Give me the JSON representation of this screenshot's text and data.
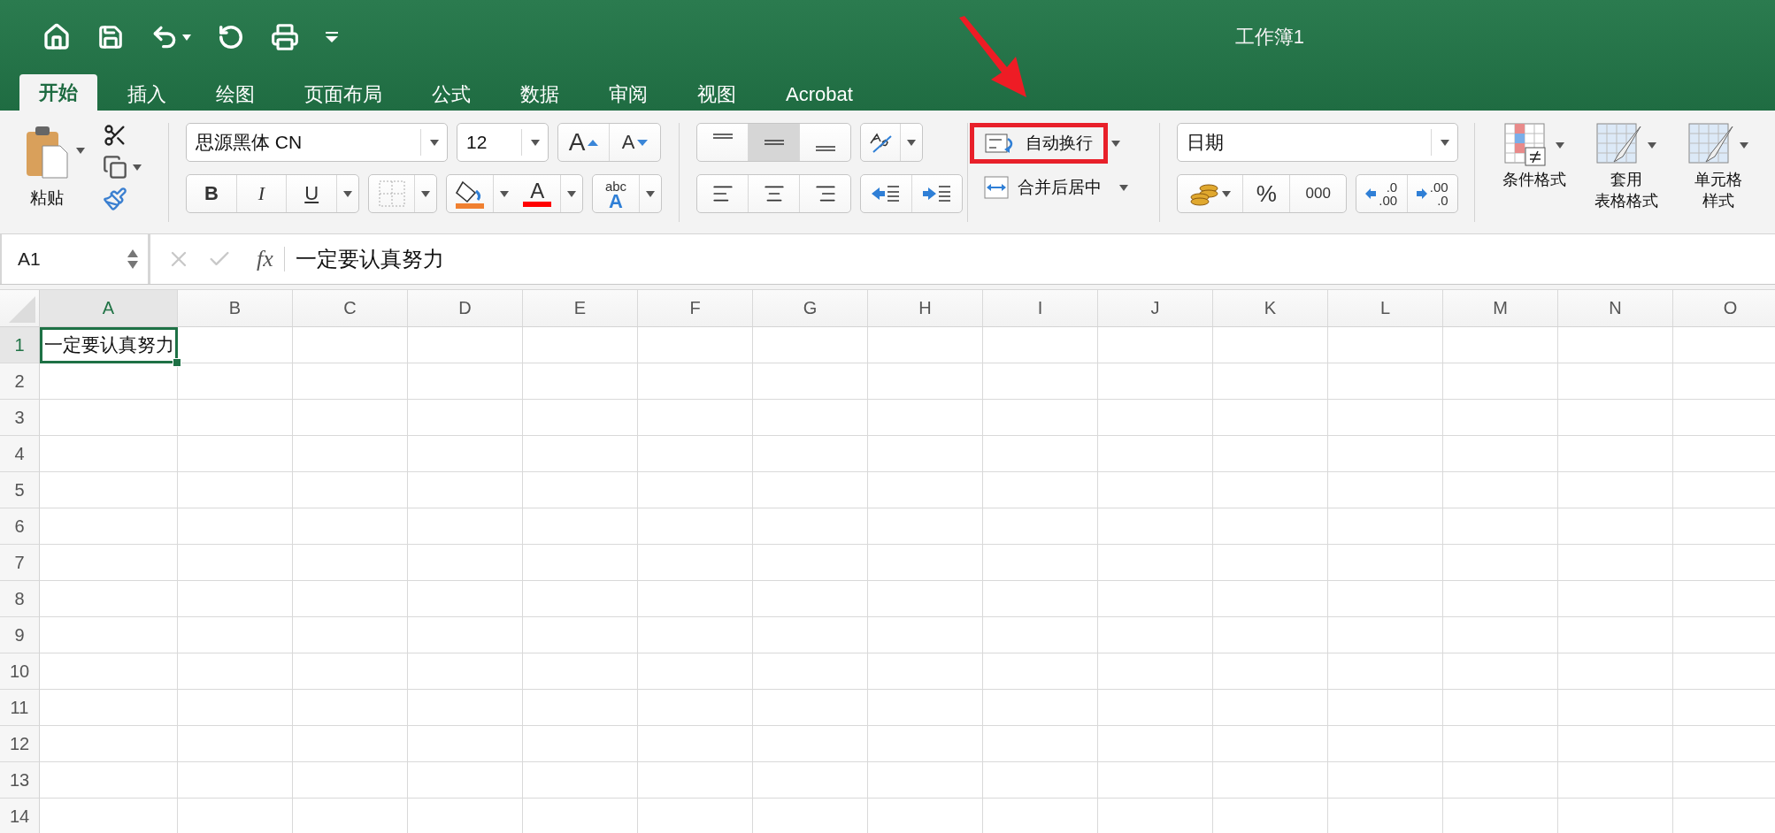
{
  "window": {
    "title": "工作簿1"
  },
  "tabs": [
    {
      "label": "开始",
      "selected": true
    },
    {
      "label": "插入",
      "selected": false
    },
    {
      "label": "绘图",
      "selected": false
    },
    {
      "label": "页面布局",
      "selected": false
    },
    {
      "label": "公式",
      "selected": false
    },
    {
      "label": "数据",
      "selected": false
    },
    {
      "label": "审阅",
      "selected": false
    },
    {
      "label": "视图",
      "selected": false
    },
    {
      "label": "Acrobat",
      "selected": false
    }
  ],
  "ribbon": {
    "paste": {
      "label": "粘贴"
    },
    "font": {
      "name": "思源黑体 CN",
      "size": "12",
      "grow_label": "A",
      "shrink_label": "A",
      "styles": [
        "B",
        "I",
        "U"
      ],
      "color_label": "A",
      "phonetic": [
        "abc",
        "A"
      ]
    },
    "alignment": {
      "vertical": [
        {
          "selected": false
        },
        {
          "selected": true
        },
        {
          "selected": false
        }
      ]
    },
    "wrap_text": {
      "label": "自动换行",
      "highlighted": true
    },
    "merge": {
      "label": "合并后居中"
    },
    "number": {
      "format": "日期",
      "percent": "%",
      "thousands": "000",
      "increase_decimal": [
        ".0",
        ".00"
      ],
      "decrease_decimal": [
        ".00",
        ".0"
      ]
    },
    "styles": [
      {
        "lines": [
          "条件格式"
        ]
      },
      {
        "lines": [
          "套用",
          "表格格式"
        ]
      },
      {
        "lines": [
          "单元格",
          "样式"
        ]
      }
    ]
  },
  "formula_bar": {
    "name_box": "A1",
    "fx": "fx",
    "formula": "一定要认真努力"
  },
  "sheet": {
    "columns": [
      {
        "label": "A",
        "selected": true
      },
      {
        "label": "B",
        "selected": false
      },
      {
        "label": "C",
        "selected": false
      },
      {
        "label": "D",
        "selected": false
      },
      {
        "label": "E",
        "selected": false
      },
      {
        "label": "F",
        "selected": false
      },
      {
        "label": "G",
        "selected": false
      },
      {
        "label": "H",
        "selected": false
      },
      {
        "label": "I",
        "selected": false
      },
      {
        "label": "J",
        "selected": false
      },
      {
        "label": "K",
        "selected": false
      },
      {
        "label": "L",
        "selected": false
      },
      {
        "label": "M",
        "selected": false
      },
      {
        "label": "N",
        "selected": false
      },
      {
        "label": "O",
        "selected": false
      }
    ],
    "rows": [
      {
        "label": "1",
        "selected": true,
        "value": "一定要认真努力"
      },
      {
        "label": "2",
        "selected": false
      },
      {
        "label": "3",
        "selected": false
      },
      {
        "label": "4",
        "selected": false
      },
      {
        "label": "5",
        "selected": false
      },
      {
        "label": "6",
        "selected": false
      },
      {
        "label": "7",
        "selected": false
      },
      {
        "label": "8",
        "selected": false
      },
      {
        "label": "9",
        "selected": false
      },
      {
        "label": "10",
        "selected": false
      },
      {
        "label": "11",
        "selected": false
      },
      {
        "label": "12",
        "selected": false
      },
      {
        "label": "13",
        "selected": false
      },
      {
        "label": "14",
        "selected": false
      }
    ]
  },
  "annotation": {
    "kind": "arrow"
  }
}
